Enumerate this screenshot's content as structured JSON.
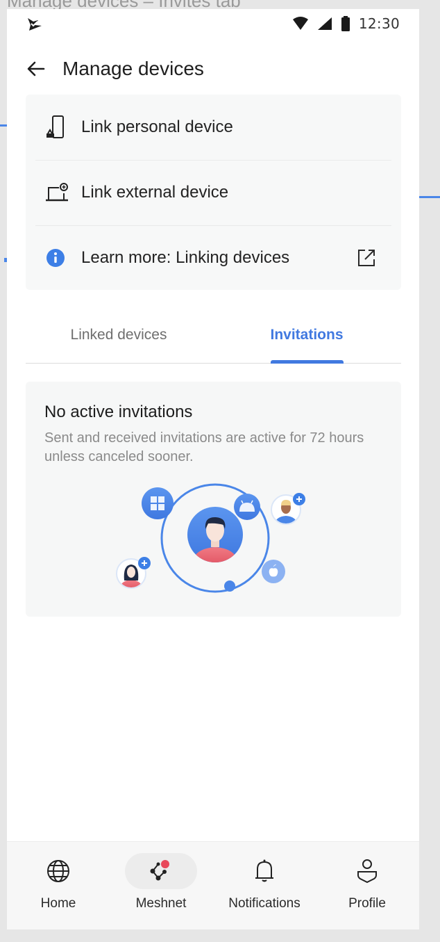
{
  "canvas": {
    "caption": "Manage devices – Invites tab"
  },
  "status_bar": {
    "left_icon": "app-notification-icon",
    "icons": [
      "wifi-icon",
      "cellular-signal-icon",
      "battery-icon"
    ],
    "time": "12:30"
  },
  "app_bar": {
    "back_icon": "arrow-left-icon",
    "title": "Manage devices"
  },
  "menu": {
    "items": [
      {
        "icon": "phone-link-icon",
        "label": "Link personal device"
      },
      {
        "icon": "laptop-add-icon",
        "label": "Link external device"
      },
      {
        "icon": "info-icon",
        "label": "Learn more: Linking devices",
        "trailing_icon": "external-link-icon"
      }
    ]
  },
  "tabs": {
    "items": [
      {
        "label": "Linked devices",
        "selected": false
      },
      {
        "label": "Invitations",
        "selected": true
      }
    ]
  },
  "empty_state": {
    "title": "No active invitations",
    "description": "Sent and received invitations are active for 72 hours unless canceled sooner.",
    "illustration": "meshnet-devices-illustration"
  },
  "bottom_nav": {
    "items": [
      {
        "icon": "globe-icon",
        "label": "Home",
        "active": false
      },
      {
        "icon": "meshnet-icon",
        "label": "Meshnet",
        "active": true,
        "badge": true
      },
      {
        "icon": "bell-icon",
        "label": "Notifications",
        "active": false
      },
      {
        "icon": "profile-icon",
        "label": "Profile",
        "active": false
      }
    ]
  },
  "colors": {
    "accent": "#4179e0",
    "badge": "#e8485a",
    "info": "#3d7fe6",
    "card_bg": "#f7f8f8"
  }
}
